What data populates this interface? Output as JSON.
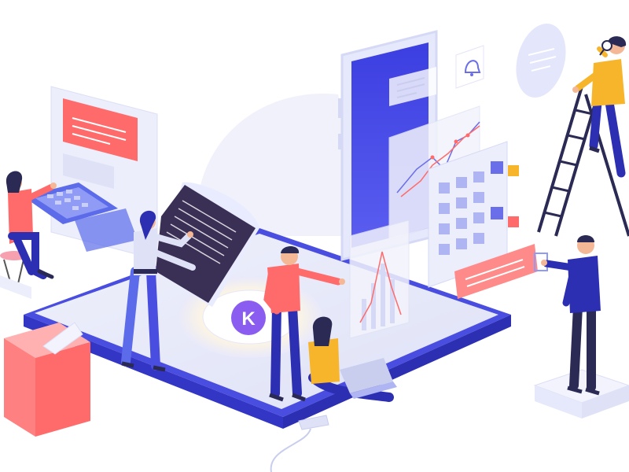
{
  "scene": {
    "badge_letter": "K"
  },
  "icons": {
    "platform": "tablet-platform-icon",
    "phone": "smartphone-icon",
    "bell": "bell-icon",
    "calendar": "calendar-grid-icon",
    "keyboard": "keyboard-icon",
    "document": "document-sheet-icon",
    "ladder": "ladder-icon",
    "laptop": "laptop-icon",
    "magnifier": "magnifier-icon",
    "box": "box-icon"
  },
  "palette": {
    "primary_blue": "#4a4ee0",
    "deep_blue": "#2d2fb3",
    "light_lavender": "#e9ebff",
    "pale_lavender": "#f2f3fc",
    "coral": "#ff6b6b",
    "yellow": "#f7b52c",
    "dark_navy": "#2a2a55",
    "skin": "#f4b896",
    "dark_purple_sheet": "#3a2f55"
  }
}
